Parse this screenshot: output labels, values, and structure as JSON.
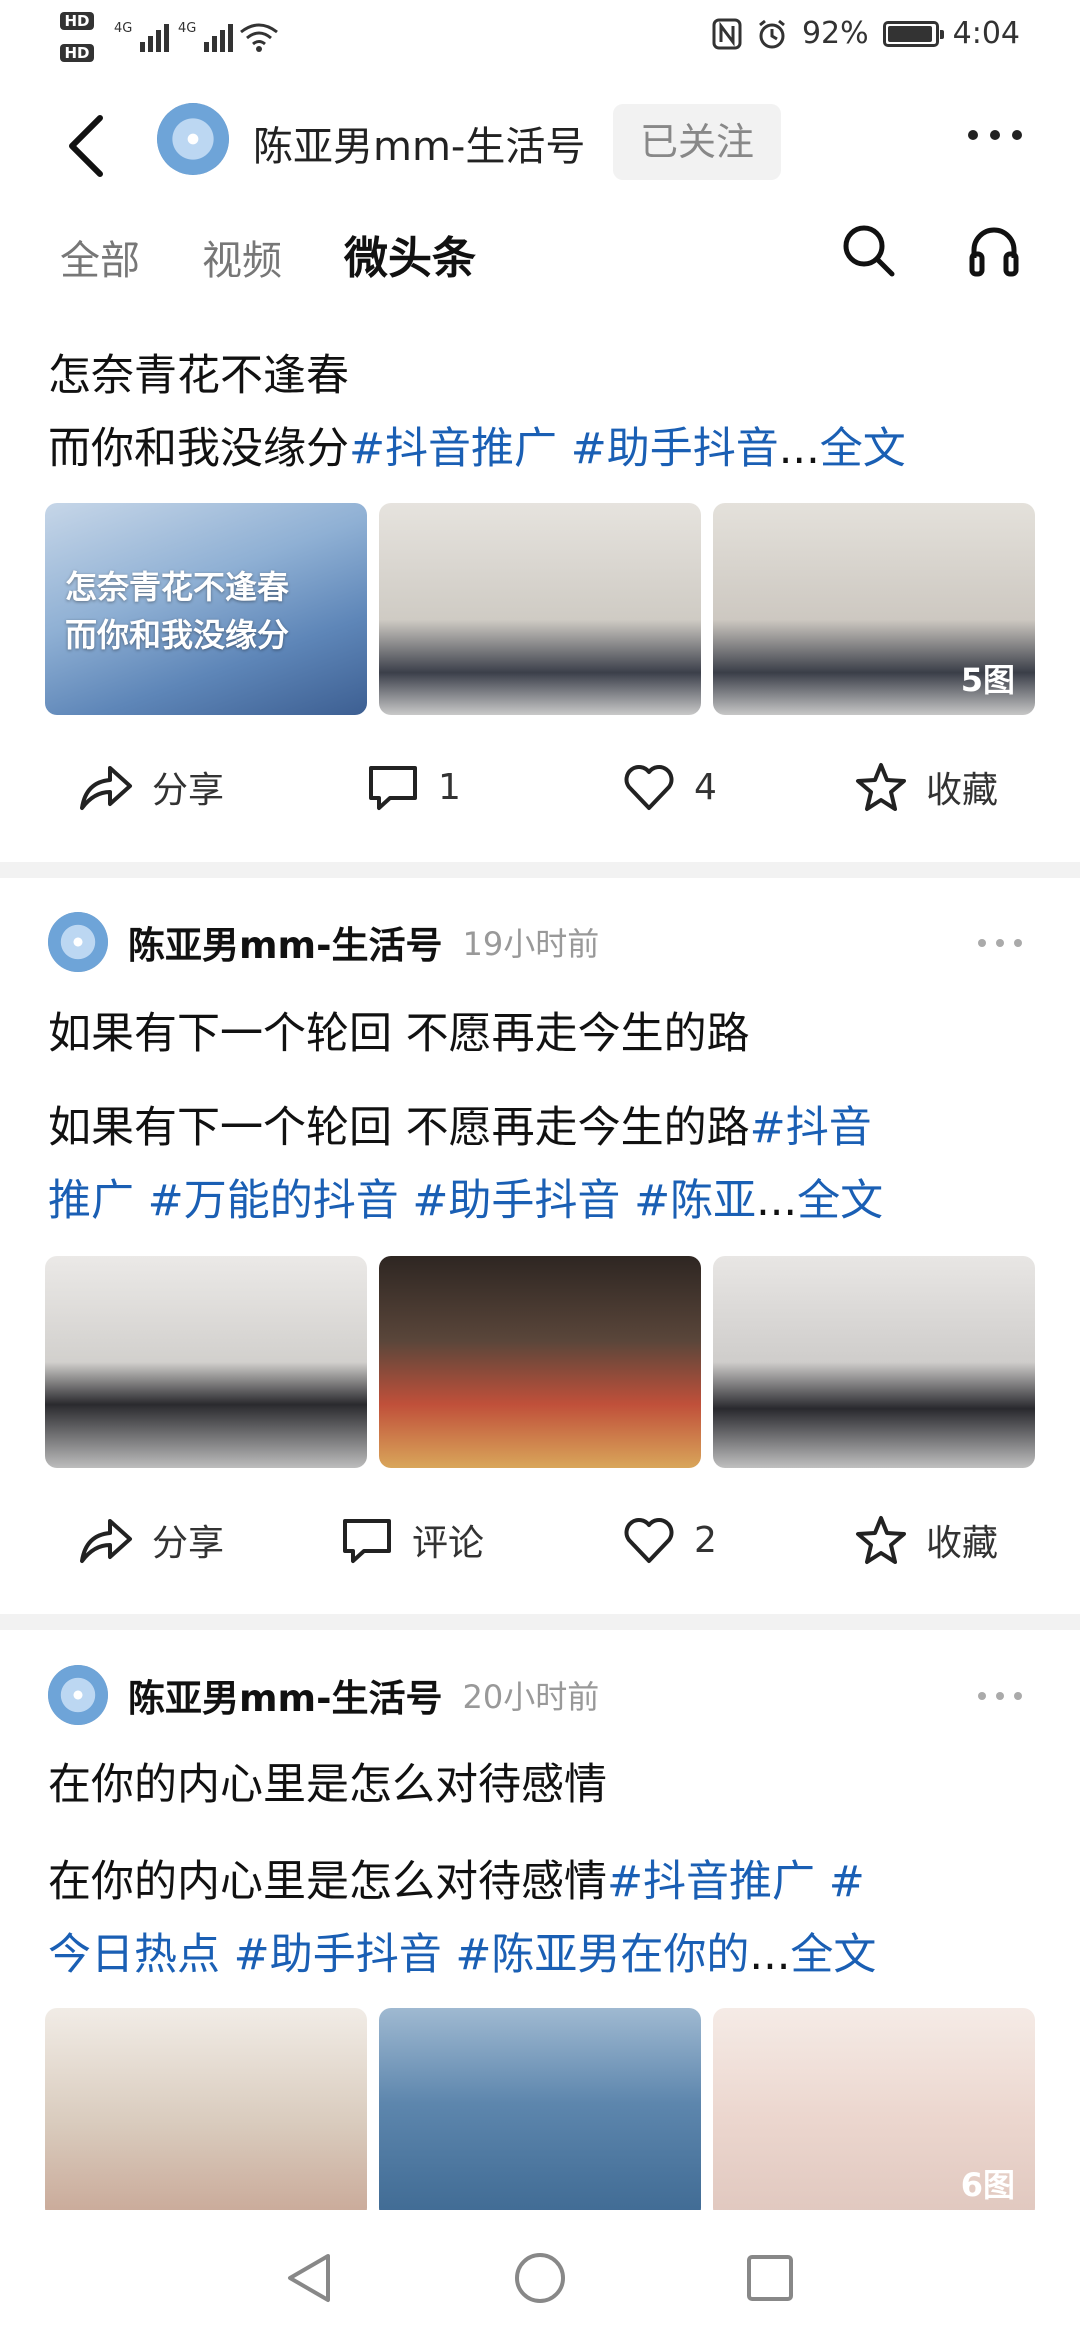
{
  "status_bar": {
    "hd1": "HD",
    "hd2": "HD",
    "net1": "4G",
    "net2": "4G",
    "battery": "92%",
    "time": "4:04"
  },
  "header": {
    "account_name": "陈亚男mm-生活号",
    "follow_label": "已关注"
  },
  "tabs": [
    {
      "label": "全部"
    },
    {
      "label": "视频"
    },
    {
      "label": "微头条"
    }
  ],
  "posts": [
    {
      "title": "怎奈青花不逢春",
      "body_prefix": "而你和我没缘分",
      "tags": "#抖音推广 #助手抖音",
      "ellipsis": "...",
      "full_label": "全文",
      "images": [
        {
          "caption": "怎奈青花不逢春\n而你和我没缘分",
          "bg": "#7fa6cf"
        },
        {
          "bg": "#d8d5cf"
        },
        {
          "bg": "#d6d3cc",
          "count": "5图"
        }
      ],
      "share_label": "分享",
      "comment_count": "1",
      "like_count": "4",
      "favorite_label": "收藏"
    },
    {
      "author": "陈亚男mm-生活号",
      "time": "19小时前",
      "title": "如果有下一个轮回 不愿再走今生的路",
      "body_prefix": "如果有下一个轮回 不愿再走今生的路",
      "tags_line1": "#抖音",
      "tags_line2": "推广 #万能的抖音 #助手抖音 #陈亚",
      "ellipsis": "...",
      "full_label": "全文",
      "images": [
        {
          "bg": "#d9d9d9"
        },
        {
          "bg": "#4a3b32"
        },
        {
          "bg": "#cfcfcf"
        }
      ],
      "share_label": "分享",
      "comment_label": "评论",
      "like_count": "2",
      "favorite_label": "收藏"
    },
    {
      "author": "陈亚男mm-生活号",
      "time": "20小时前",
      "title": "在你的内心里是怎么对待感情",
      "body_prefix": "在你的内心里是怎么对待感情",
      "tags_line1": "#抖音推广 #",
      "tags_line2": "今日热点 #助手抖音 #陈亚男在你的",
      "ellipsis": "...",
      "full_label": "全文",
      "images": [
        {
          "bg": "#e8dcd2"
        },
        {
          "bg": "#5f88ad"
        },
        {
          "bg": "#f0ddd8",
          "count": "6图"
        }
      ]
    }
  ],
  "colors": {
    "accent": "#1a5fb4",
    "separator": "#f2f2f2"
  }
}
